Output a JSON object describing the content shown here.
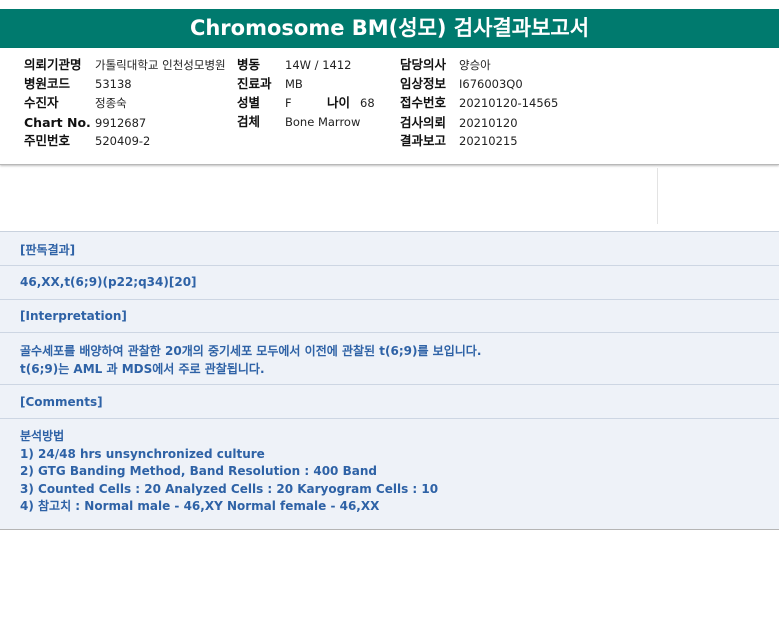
{
  "title": "Chromosome BM(성모) 검사결과보고서",
  "info": {
    "c1": [
      {
        "label": "의뢰기관명",
        "value": "가톨릭대학교 인천성모병원"
      },
      {
        "label": "병원코드",
        "value": "53138"
      },
      {
        "label": "수진자",
        "value": "정종숙"
      },
      {
        "label": "Chart No.",
        "value": "9912687"
      },
      {
        "label": "주민번호",
        "value": "520409-2"
      }
    ],
    "c2": [
      {
        "label": "병동",
        "value": "14W / 1412"
      },
      {
        "label": "진료과",
        "value": "MB"
      },
      {
        "label": "성별",
        "value": "F"
      },
      {
        "label": "검체",
        "value": "Bone Marrow"
      }
    ],
    "age": {
      "label": "나이",
      "value": "68"
    },
    "c3": [
      {
        "label": "담당의사",
        "value": "양승아"
      },
      {
        "label": "임상정보",
        "value": "I676003Q0"
      },
      {
        "label": "접수번호",
        "value": "20210120-14565"
      },
      {
        "label": "검사의뢰",
        "value": "20210120"
      },
      {
        "label": "결과보고",
        "value": "20210215"
      }
    ]
  },
  "results": {
    "judgement_header": "[판독결과]",
    "karyotype": "46,XX,t(6;9)(p22;q34)[20]",
    "interpretation_header": "[Interpretation]",
    "interpretation_lines": [
      "골수세포를 배양하여 관찰한 20개의 중기세포 모두에서 이전에 관찰된 t(6;9)를 보입니다.",
      "t(6;9)는 AML 과 MDS에서 주로 관찰됩니다."
    ],
    "comments_header": "[Comments]",
    "comments_lines": [
      "분석방법",
      "1) 24/48 hrs unsynchronized culture",
      "2) GTG Banding Method, Band Resolution : 400 Band",
      "3) Counted Cells : 20 Analyzed Cells : 20 Karyogram Cells : 10",
      "4) 참고치 : Normal male - 46,XY Normal female - 46,XX"
    ]
  }
}
